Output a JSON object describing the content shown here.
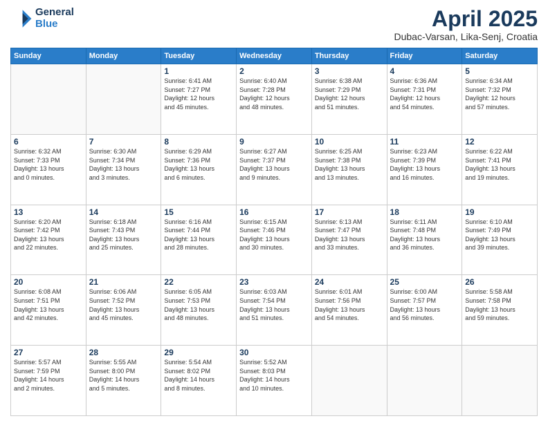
{
  "header": {
    "logo_line1": "General",
    "logo_line2": "Blue",
    "month_title": "April 2025",
    "location": "Dubac-Varsan, Lika-Senj, Croatia"
  },
  "days_of_week": [
    "Sunday",
    "Monday",
    "Tuesday",
    "Wednesday",
    "Thursday",
    "Friday",
    "Saturday"
  ],
  "weeks": [
    [
      {
        "num": "",
        "info": ""
      },
      {
        "num": "",
        "info": ""
      },
      {
        "num": "1",
        "info": "Sunrise: 6:41 AM\nSunset: 7:27 PM\nDaylight: 12 hours\nand 45 minutes."
      },
      {
        "num": "2",
        "info": "Sunrise: 6:40 AM\nSunset: 7:28 PM\nDaylight: 12 hours\nand 48 minutes."
      },
      {
        "num": "3",
        "info": "Sunrise: 6:38 AM\nSunset: 7:29 PM\nDaylight: 12 hours\nand 51 minutes."
      },
      {
        "num": "4",
        "info": "Sunrise: 6:36 AM\nSunset: 7:31 PM\nDaylight: 12 hours\nand 54 minutes."
      },
      {
        "num": "5",
        "info": "Sunrise: 6:34 AM\nSunset: 7:32 PM\nDaylight: 12 hours\nand 57 minutes."
      }
    ],
    [
      {
        "num": "6",
        "info": "Sunrise: 6:32 AM\nSunset: 7:33 PM\nDaylight: 13 hours\nand 0 minutes."
      },
      {
        "num": "7",
        "info": "Sunrise: 6:30 AM\nSunset: 7:34 PM\nDaylight: 13 hours\nand 3 minutes."
      },
      {
        "num": "8",
        "info": "Sunrise: 6:29 AM\nSunset: 7:36 PM\nDaylight: 13 hours\nand 6 minutes."
      },
      {
        "num": "9",
        "info": "Sunrise: 6:27 AM\nSunset: 7:37 PM\nDaylight: 13 hours\nand 9 minutes."
      },
      {
        "num": "10",
        "info": "Sunrise: 6:25 AM\nSunset: 7:38 PM\nDaylight: 13 hours\nand 13 minutes."
      },
      {
        "num": "11",
        "info": "Sunrise: 6:23 AM\nSunset: 7:39 PM\nDaylight: 13 hours\nand 16 minutes."
      },
      {
        "num": "12",
        "info": "Sunrise: 6:22 AM\nSunset: 7:41 PM\nDaylight: 13 hours\nand 19 minutes."
      }
    ],
    [
      {
        "num": "13",
        "info": "Sunrise: 6:20 AM\nSunset: 7:42 PM\nDaylight: 13 hours\nand 22 minutes."
      },
      {
        "num": "14",
        "info": "Sunrise: 6:18 AM\nSunset: 7:43 PM\nDaylight: 13 hours\nand 25 minutes."
      },
      {
        "num": "15",
        "info": "Sunrise: 6:16 AM\nSunset: 7:44 PM\nDaylight: 13 hours\nand 28 minutes."
      },
      {
        "num": "16",
        "info": "Sunrise: 6:15 AM\nSunset: 7:46 PM\nDaylight: 13 hours\nand 30 minutes."
      },
      {
        "num": "17",
        "info": "Sunrise: 6:13 AM\nSunset: 7:47 PM\nDaylight: 13 hours\nand 33 minutes."
      },
      {
        "num": "18",
        "info": "Sunrise: 6:11 AM\nSunset: 7:48 PM\nDaylight: 13 hours\nand 36 minutes."
      },
      {
        "num": "19",
        "info": "Sunrise: 6:10 AM\nSunset: 7:49 PM\nDaylight: 13 hours\nand 39 minutes."
      }
    ],
    [
      {
        "num": "20",
        "info": "Sunrise: 6:08 AM\nSunset: 7:51 PM\nDaylight: 13 hours\nand 42 minutes."
      },
      {
        "num": "21",
        "info": "Sunrise: 6:06 AM\nSunset: 7:52 PM\nDaylight: 13 hours\nand 45 minutes."
      },
      {
        "num": "22",
        "info": "Sunrise: 6:05 AM\nSunset: 7:53 PM\nDaylight: 13 hours\nand 48 minutes."
      },
      {
        "num": "23",
        "info": "Sunrise: 6:03 AM\nSunset: 7:54 PM\nDaylight: 13 hours\nand 51 minutes."
      },
      {
        "num": "24",
        "info": "Sunrise: 6:01 AM\nSunset: 7:56 PM\nDaylight: 13 hours\nand 54 minutes."
      },
      {
        "num": "25",
        "info": "Sunrise: 6:00 AM\nSunset: 7:57 PM\nDaylight: 13 hours\nand 56 minutes."
      },
      {
        "num": "26",
        "info": "Sunrise: 5:58 AM\nSunset: 7:58 PM\nDaylight: 13 hours\nand 59 minutes."
      }
    ],
    [
      {
        "num": "27",
        "info": "Sunrise: 5:57 AM\nSunset: 7:59 PM\nDaylight: 14 hours\nand 2 minutes."
      },
      {
        "num": "28",
        "info": "Sunrise: 5:55 AM\nSunset: 8:00 PM\nDaylight: 14 hours\nand 5 minutes."
      },
      {
        "num": "29",
        "info": "Sunrise: 5:54 AM\nSunset: 8:02 PM\nDaylight: 14 hours\nand 8 minutes."
      },
      {
        "num": "30",
        "info": "Sunrise: 5:52 AM\nSunset: 8:03 PM\nDaylight: 14 hours\nand 10 minutes."
      },
      {
        "num": "",
        "info": ""
      },
      {
        "num": "",
        "info": ""
      },
      {
        "num": "",
        "info": ""
      }
    ]
  ]
}
